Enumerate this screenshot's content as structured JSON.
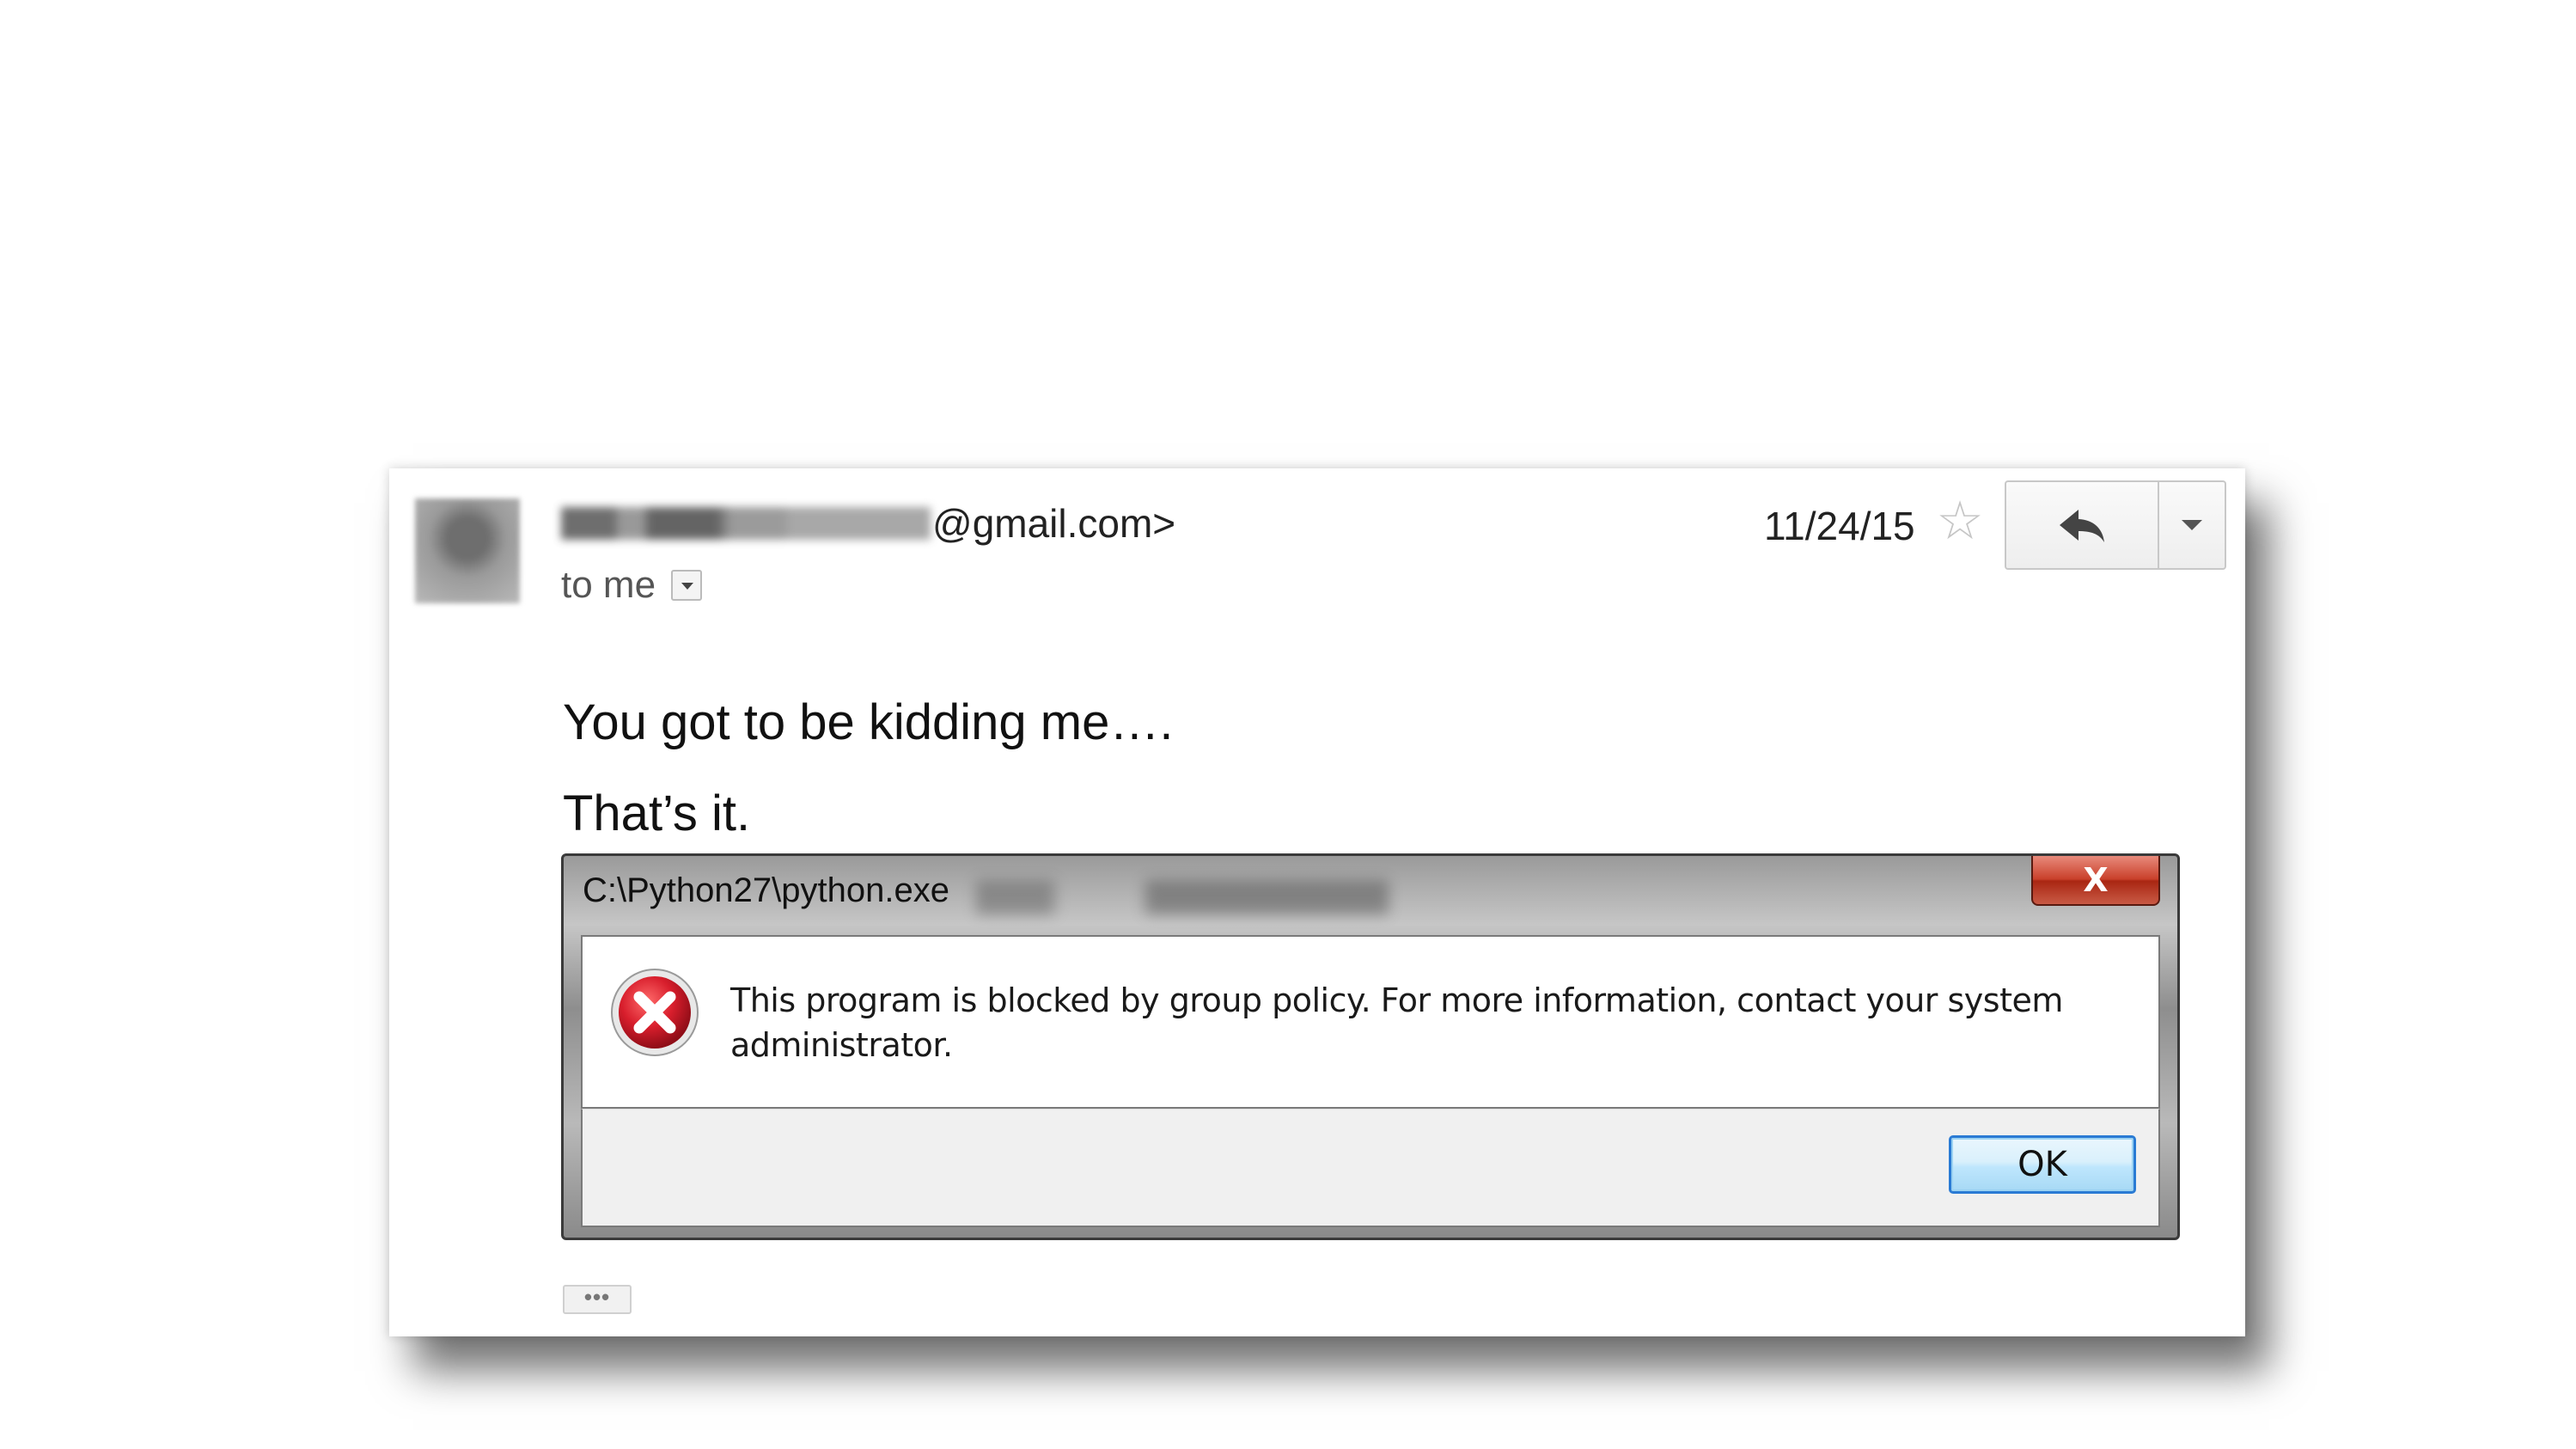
{
  "email": {
    "sender_email": "@gmail.com>",
    "recipient_label": "to me",
    "date": "11/24/15",
    "body_lines": [
      "You got to be kidding me….",
      "That’s it."
    ],
    "more_label": "•••"
  },
  "dialog": {
    "title": "C:\\Python27\\python.exe",
    "message": "This program is blocked by group policy. For more information, contact your system administrator.",
    "ok_label": "OK",
    "close_label": "X"
  },
  "icons": {
    "star": "star-icon",
    "reply": "reply-icon",
    "more": "chevron-down-icon",
    "error": "error-icon"
  },
  "colors": {
    "star": "#c6c6c6",
    "close_button": "#c9402b",
    "ok_border": "#2a7bd4",
    "error_red": "#c8102e"
  }
}
